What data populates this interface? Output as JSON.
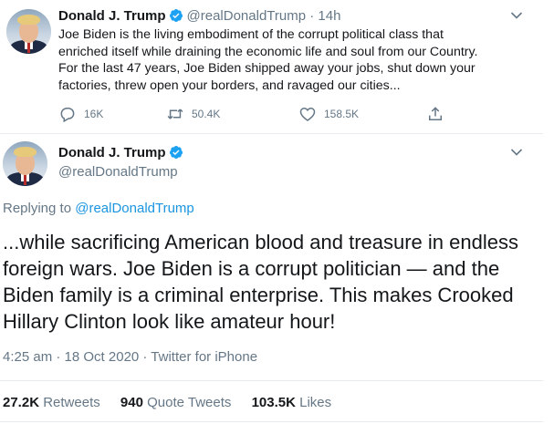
{
  "parent_tweet": {
    "author_name": "Donald J. Trump",
    "handle": "@realDonaldTrump",
    "dot": "·",
    "time": "14h",
    "text": "Joe Biden is the living embodiment of the corrupt political class that\nenriched itself while draining the economic life and soul from our Country.\nFor the last 47 years, Joe Biden shipped away your jobs, shut down your\nfactories, threw open your borders, and ravaged our cities...",
    "reply_count": "16K",
    "retweet_count": "50.4K",
    "like_count": "158.5K"
  },
  "main_tweet": {
    "author_name": "Donald J. Trump",
    "handle": "@realDonaldTrump",
    "replying_prefix": "Replying to",
    "replying_to": "@realDonaldTrump",
    "text": "...while sacrificing American blood and treasure in endless foreign wars. Joe Biden is a corrupt politician — and the Biden family is a criminal enterprise. This makes Crooked Hillary Clinton look like amateur hour!",
    "timestamp": "4:25 am · 18 Oct 2020 · Twitter for iPhone",
    "retweets_value": "27.2K",
    "retweets_label": "Retweets",
    "quote_value": "940",
    "quote_label": "Quote Tweets",
    "likes_value": "103.5K",
    "likes_label": "Likes"
  },
  "icons": {
    "verified": "verified-badge-icon",
    "caret": "chevron-down-icon",
    "reply": "reply-icon",
    "retweet": "retweet-icon",
    "like": "heart-icon",
    "share": "share-icon"
  },
  "colors": {
    "accent": "#1da1f2",
    "link": "#1b95e0",
    "text": "#14171a",
    "muted": "#657786",
    "divider": "#e6ecf0"
  }
}
